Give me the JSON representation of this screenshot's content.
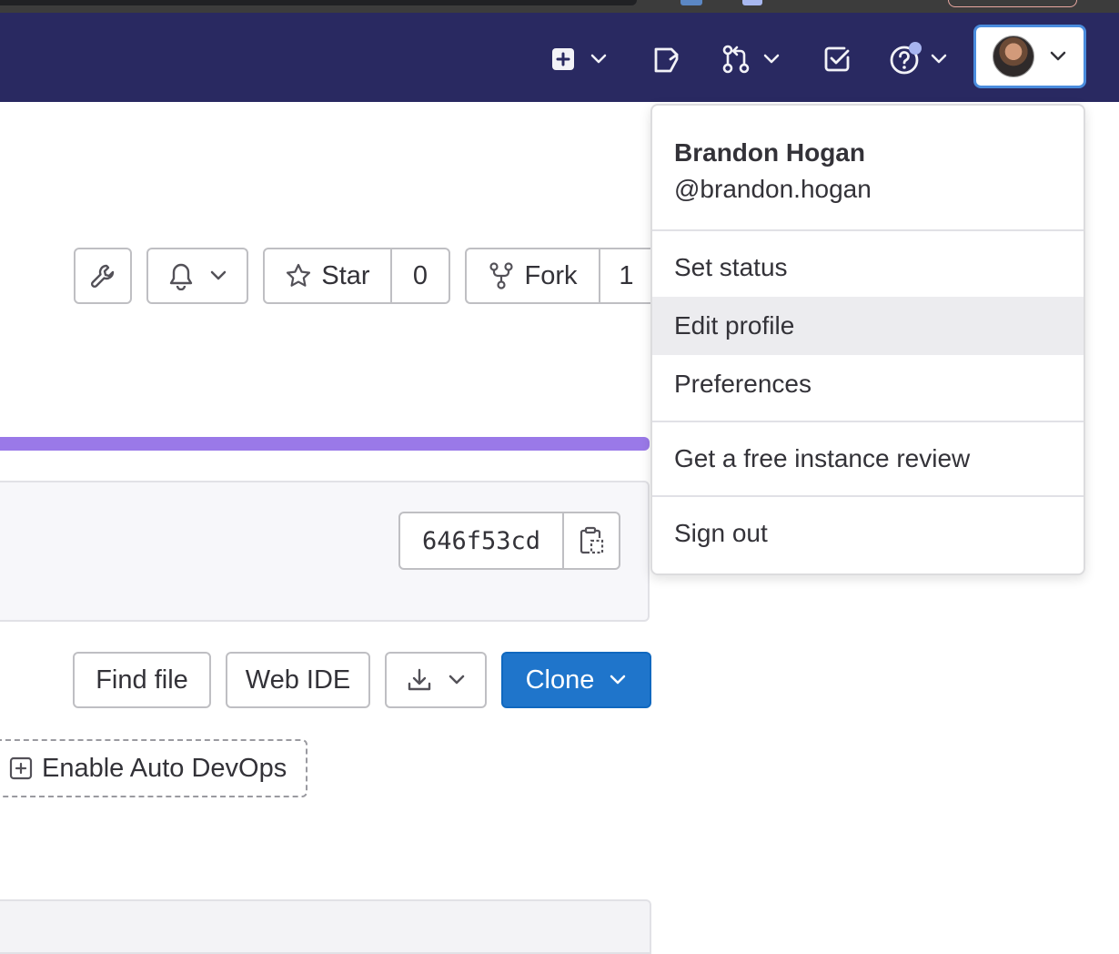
{
  "navbar": {
    "icons": [
      "plus-square-icon",
      "issues-icon",
      "merge-request-icon",
      "todo-icon",
      "help-icon"
    ],
    "bg_color": "#292961",
    "help_badge_color": "#a7b4ef"
  },
  "project_actions": {
    "star_label": "Star",
    "star_count": "0",
    "fork_label": "Fork",
    "fork_count": "1"
  },
  "commit": {
    "sha": "646f53cd"
  },
  "file_actions": {
    "find_file": "Find file",
    "web_ide": "Web IDE",
    "clone": "Clone",
    "enable_auto_devops": "Enable Auto DevOps"
  },
  "user_menu": {
    "name": "Brandon Hogan",
    "username": "@brandon.hogan",
    "items": [
      {
        "label": "Set status"
      },
      {
        "label": "Edit profile",
        "active": true
      },
      {
        "label": "Preferences"
      },
      {
        "label": "Get a free instance review"
      },
      {
        "label": "Sign out"
      }
    ]
  },
  "colors": {
    "accent_purple": "#9a79e8",
    "clone_blue": "#1f75cb",
    "focus_ring": "#4a8cdd"
  }
}
